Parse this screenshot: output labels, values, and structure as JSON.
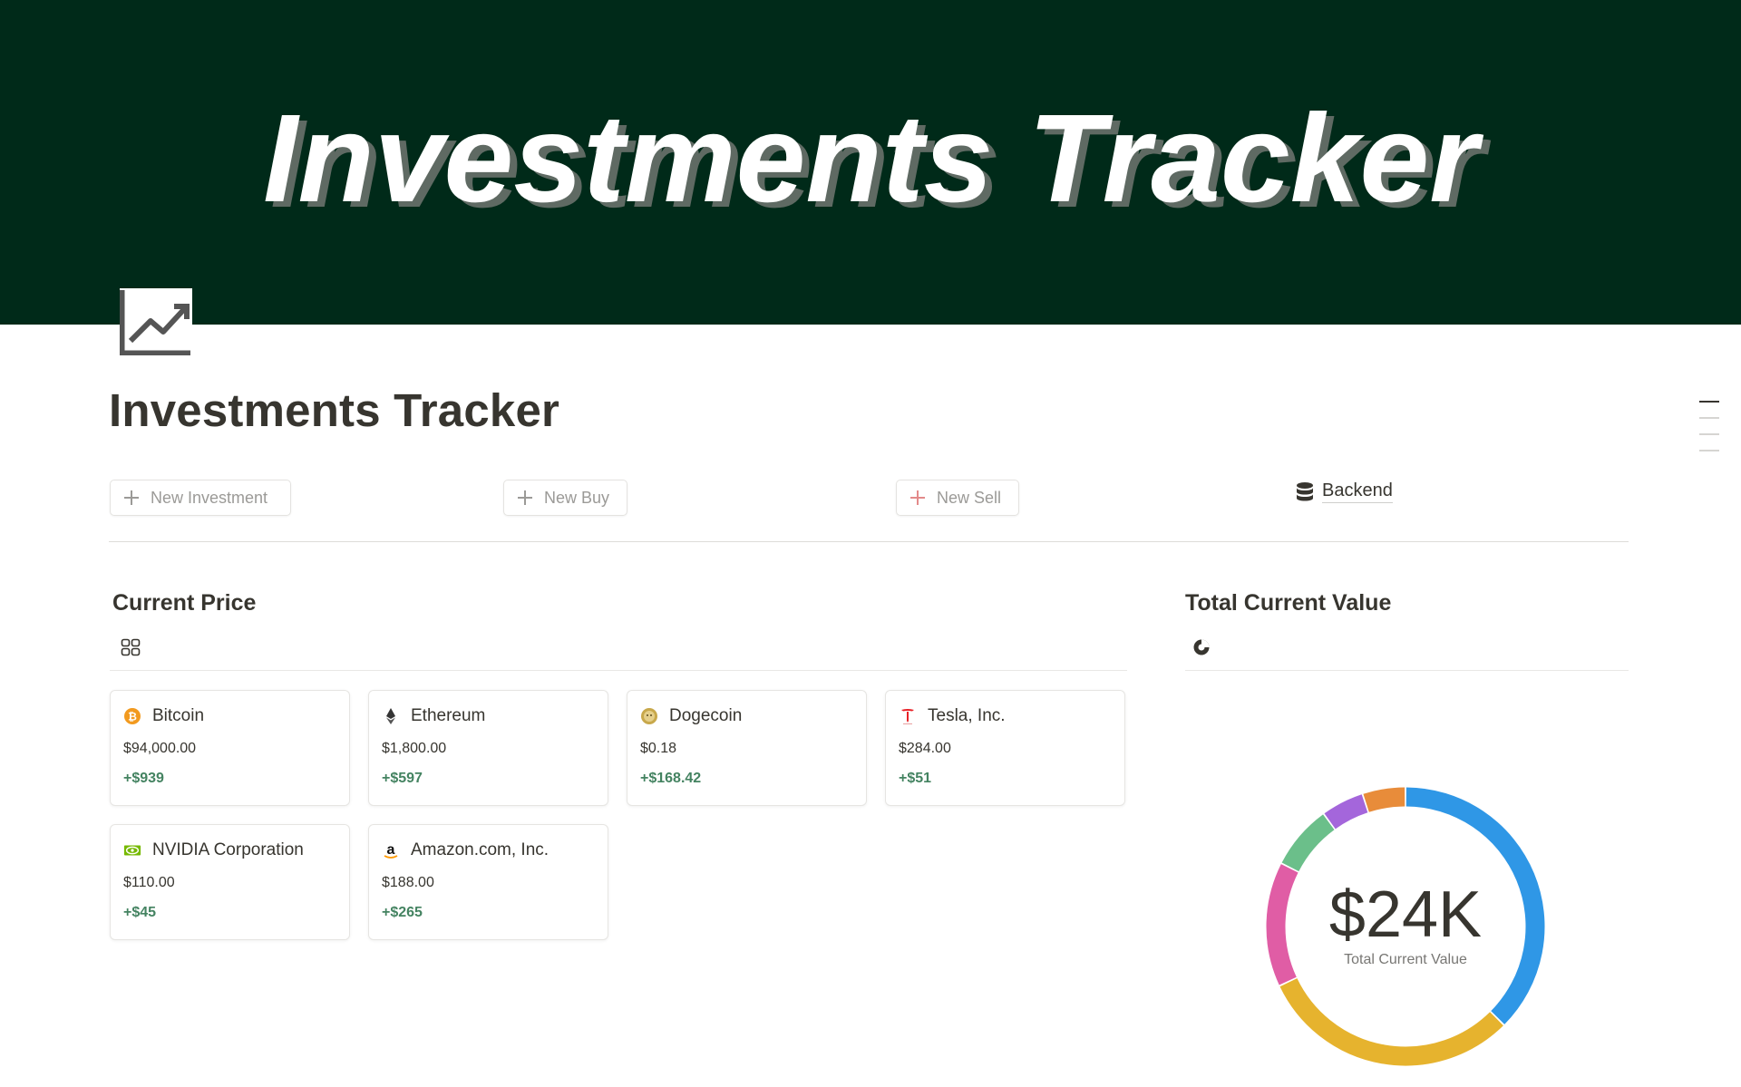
{
  "banner": {
    "text": "Investments Tracker"
  },
  "page": {
    "title": "Investments Tracker",
    "icon": "line-chart-icon"
  },
  "actions": {
    "new_investment": "New Investment",
    "new_buy": "New Buy",
    "new_sell": "New Sell",
    "backend": "Backend"
  },
  "current_price": {
    "title": "Current Price",
    "view_icon": "gallery-view-icon",
    "cards": [
      {
        "name": "Bitcoin",
        "price": "$94,000.00",
        "change": "+$939",
        "icon": "bitcoin-icon"
      },
      {
        "name": "Ethereum",
        "price": "$1,800.00",
        "change": "+$597",
        "icon": "ethereum-icon"
      },
      {
        "name": "Dogecoin",
        "price": "$0.18",
        "change": "+$168.42",
        "icon": "dogecoin-icon"
      },
      {
        "name": "Tesla, Inc.",
        "price": "$284.00",
        "change": "+$51",
        "icon": "tesla-icon"
      },
      {
        "name": "NVIDIA Corporation",
        "price": "$110.00",
        "change": "+$45",
        "icon": "nvidia-icon"
      },
      {
        "name": "Amazon.com, Inc.",
        "price": "$188.00",
        "change": "+$265",
        "icon": "amazon-icon"
      }
    ]
  },
  "total_current_value": {
    "title": "Total Current Value",
    "view_icon": "pie-chart-icon",
    "value": "$24K",
    "label": "Total Current Value"
  },
  "chart_data": {
    "type": "pie",
    "variant": "donut",
    "title": "Total Current Value",
    "center_value": "$24K",
    "center_label": "Total Current Value",
    "slices": [
      {
        "share": 0.375,
        "color": "#2f97e6"
      },
      {
        "share": 0.305,
        "color": "#e6b32e"
      },
      {
        "share": 0.145,
        "color": "#e05da5"
      },
      {
        "share": 0.075,
        "color": "#6bbf8a"
      },
      {
        "share": 0.05,
        "color": "#a466db"
      },
      {
        "share": 0.05,
        "color": "#e88c3a"
      }
    ]
  },
  "colors": {
    "banner_bg": "#002a19",
    "positive": "#448361",
    "text": "#37352f",
    "muted": "#9b9a97"
  }
}
